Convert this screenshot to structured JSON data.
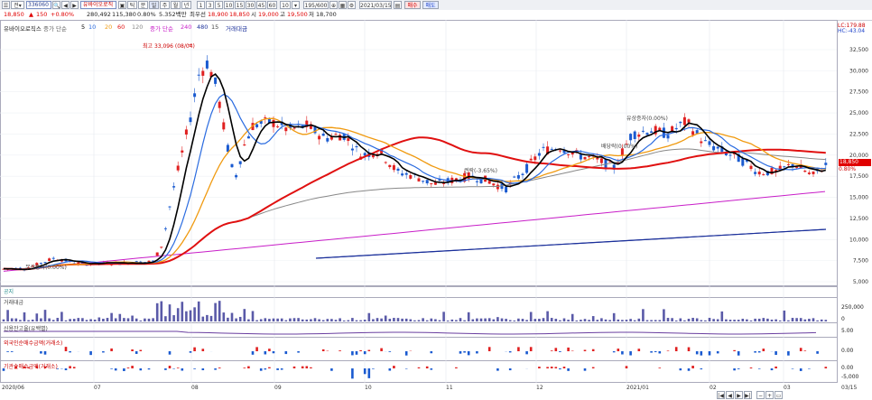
{
  "toolbar": {
    "code": "336060",
    "name": "유바이오로직",
    "period_buttons": [
      "틱",
      "분",
      "일",
      "주",
      "월",
      "년"
    ],
    "minute_buttons": [
      "1",
      "3",
      "5",
      "10",
      "15",
      "30",
      "45",
      "60"
    ],
    "min_input": "10",
    "count": "195/600",
    "date": "2021/03/15",
    "buy_button": "매수",
    "sell_button": "매도"
  },
  "quote": {
    "price": "18,850",
    "change": "150",
    "change_pct": "+0.80%",
    "volume": "280,492",
    "amount": "115,380",
    "ratio": "0.80%",
    "amt_text": "5.352백만",
    "prev_label": "최우선",
    "prev": "18,900",
    "prev2": "18,850",
    "open_label": "시",
    "open": "19,000",
    "high_label": "고",
    "high": "19,500",
    "low_label": "저",
    "low": "18,700"
  },
  "main_chart": {
    "legend_name": "유바이오로직스",
    "legend_ma": "중가 단순",
    "legend_ma_periods": [
      "5",
      "10",
      "20",
      "60",
      "120"
    ],
    "legend_ma2": "중가 단순",
    "legend_ma2_periods": [
      "240",
      "480",
      "15"
    ],
    "legend_vol": "거래대금",
    "corner_top": "LC:179.88",
    "corner_bot": "HC:-43.04",
    "high_label": "최고 33,096 (08/04)",
    "annot1": "유상증자(0.00%)",
    "annot2": "배당락(0.00%)",
    "annot3": "권락(-3.65%)",
    "annot4": "무상증자(0.00%)",
    "price_tag": "18,850",
    "price_tag_pct": "0.80%",
    "y_ticks": [
      "32,500",
      "30,000",
      "27,500",
      "25,000",
      "22,500",
      "20,000",
      "17,500",
      "15,000",
      "12,500",
      "10,000",
      "7,500",
      "5,000"
    ]
  },
  "panels": {
    "p1": "공지",
    "p2": "거래대금",
    "p2_ticks": [
      "250,000",
      "0"
    ],
    "p3": "신용잔고율(유백별)",
    "p3_ticks": [
      "5.00"
    ],
    "p4": "외국인순매수금액(거래소)",
    "p4_ticks": [
      "0.00"
    ],
    "p5": "기관순매수금액(거래소)",
    "p5_ticks": [
      "0.00",
      "-5,000"
    ]
  },
  "x_axis": [
    "2020/06",
    "07",
    "08",
    "09",
    "10",
    "11",
    "12",
    "2021/01",
    "02",
    "03",
    "03/15"
  ]
}
